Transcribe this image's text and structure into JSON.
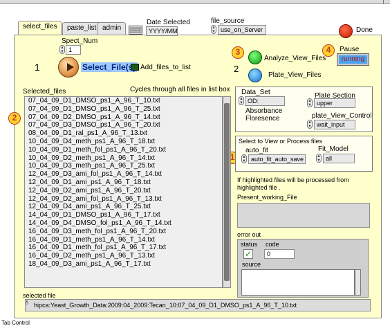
{
  "tabs": [
    "select_files",
    "paste_list",
    "admin"
  ],
  "tab_icon_text": "▒▒▒",
  "date": {
    "label": "Date Selected",
    "value": "YYYY/MM"
  },
  "file_source": {
    "label": "file_source",
    "value": "use_on_Server"
  },
  "done_label": "Done",
  "spect_num": {
    "label": "Spect_Num",
    "value": "1"
  },
  "select_files_label": "Select_File(s)",
  "add_files_label": "Add_files_to_list",
  "analyze_label": "Analyze_View_Files",
  "plate_view_label": "Plate_View_Files",
  "pause": {
    "label": "Pause",
    "value": "running"
  },
  "markers": {
    "one": "1",
    "two": "2"
  },
  "badges": {
    "b1": "1",
    "b2": "2",
    "b3": "3",
    "b4": "4"
  },
  "selected_files_label": "Selected_files",
  "cycles_label": "Cycles through  all files in  list box",
  "files": [
    "07_04_09_D1_DMSO_ps1_A_96_T_10.txt",
    "07_04_09_D1_DMSO_ps1_A_96_T_25.txt",
    "07_04_09_D2_DMSO_ps1_A_96_T_14.txt",
    "07_04_09_D3_DMSO_ps1_A_96_T_20.txt",
    "08_04_09_D1_ral_ps1_A_96_T_13.txt",
    "10_04_09_D4_meth_ps1_A_96_T_18.txt",
    "10_04_09_D1_meth_fol_ps1_A_96_T_20.txt",
    "10_04_09_D2_meth_ps1_A_96_T_14.txt",
    "10_04_09_D3_meth_ps1_A_96_T_25.txt",
    "12_04_09_D3_ami_fol_ps1_A_96_T_14.txt",
    "12_04_09_D1_ami_ps1_A_96_T_18.txt",
    "12_04_09_D2_ami_ps1_A_96_T_20.txt",
    "12_04_09_D2_ami_fol_ps1_A_96_T_13.txt",
    "12_04_09_D4_ami_ps1_A_96_T_25.txt",
    "14_04_09_D1_DMSO_ps1_A_96_T_17.txt",
    "14_04_09_D4_DMSO_fol_ps1_A_96_T_14.txt",
    "16_04_09_D3_meth_fol_ps1_A_96_T_20.txt",
    "16_04_09_D1_meth_ps1_A_96_T_14.txt",
    "16_04_09_D1_meth_fol_ps1_A_96_T_17.txt",
    "16_04_09_D2_meth_ps1_A_96_T_13.txt",
    "18_04_09_D3_ami_ps1_A_96_T_17.txt"
  ],
  "data_set": {
    "label": "Data_Set",
    "value": "OD:",
    "options": [
      "Absorbance",
      "Floresence"
    ]
  },
  "plate_section": {
    "label": "Plate Section",
    "value": "upper"
  },
  "plate_view_control": {
    "label": "plate_View_Control",
    "value": "wait_input"
  },
  "select_view_label": "Select to View or Process files",
  "auto_fit": {
    "label": "auto_fit",
    "value": "auto_fit_auto_save"
  },
  "fit_model": {
    "label": "Fit_Model",
    "value": "all"
  },
  "highlight_note": "If highlighted files will be processed from highlighted file .",
  "pwf_label": "Present_working_File",
  "error": {
    "title": "error out",
    "status_label": "status",
    "code_label": "code",
    "code_value": "0",
    "source_label": "source"
  },
  "selected_file": {
    "label": "selected file",
    "value": "hipca:Yeast_Growth_Data:2009:04_2009:Tecan_10:07_04_09_D1_DMSO_ps1_A_96_T_10.txt"
  },
  "tab_control_label": "Tab Control"
}
